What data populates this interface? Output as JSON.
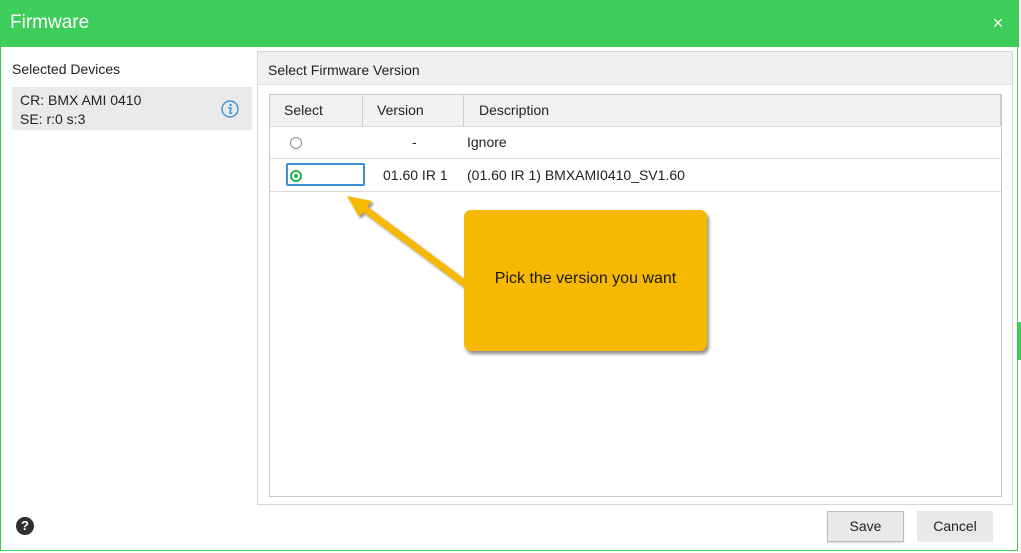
{
  "window": {
    "title": "Firmware",
    "close_glyph": "×"
  },
  "left": {
    "heading": "Selected Devices",
    "device": {
      "line1": "CR: BMX AMI 0410",
      "line2": "SE:  r:0 s:3",
      "info_icon": "info-icon"
    }
  },
  "right": {
    "heading": "Select Firmware Version",
    "columns": [
      "Select",
      "Version",
      "Description"
    ],
    "rows": [
      {
        "selected": false,
        "version": "-",
        "description": "Ignore"
      },
      {
        "selected": true,
        "version": "01.60 IR 1",
        "description": "(01.60 IR 1) BMXAMI0410_SV1.60"
      }
    ]
  },
  "footer": {
    "help_glyph": "?",
    "save_label": "Save",
    "cancel_label": "Cancel"
  },
  "callout": {
    "text": "Pick the version you want"
  },
  "colors": {
    "accent": "#3ccd5a",
    "callout": "#f6b800",
    "focus": "#3b8ed8",
    "radio_selected": "#22b14c"
  }
}
